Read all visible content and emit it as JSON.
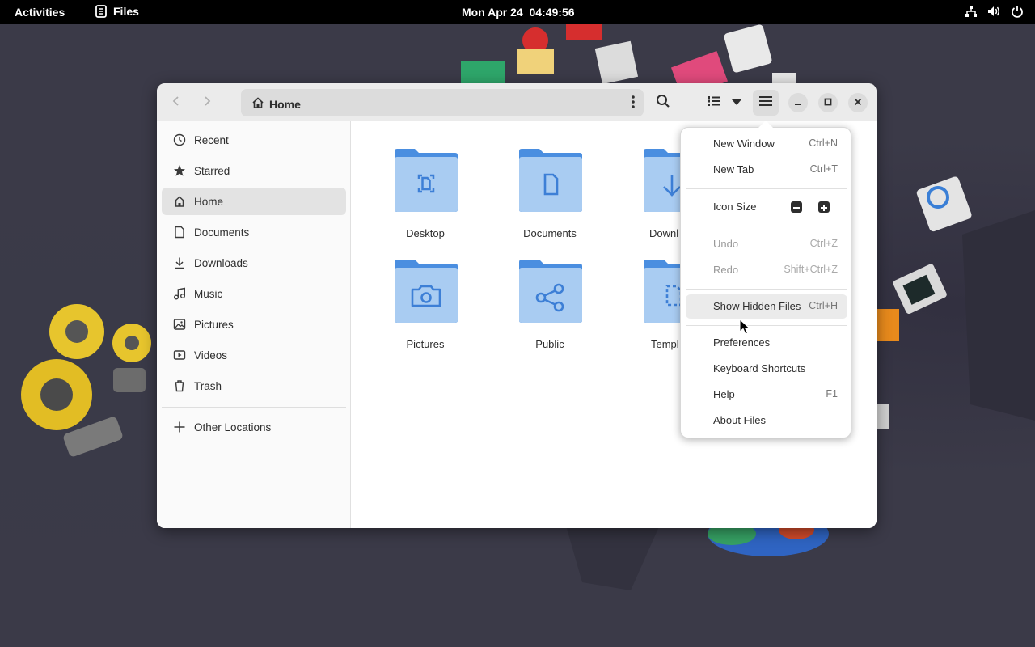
{
  "topbar": {
    "activities": "Activities",
    "app_name": "Files",
    "clock": "Mon Apr 24  04:49:56"
  },
  "window": {
    "path_label": "Home"
  },
  "sidebar": {
    "items": [
      {
        "label": "Recent",
        "icon": "clock-icon"
      },
      {
        "label": "Starred",
        "icon": "star-icon"
      },
      {
        "label": "Home",
        "icon": "home-icon"
      },
      {
        "label": "Documents",
        "icon": "document-icon"
      },
      {
        "label": "Downloads",
        "icon": "download-icon"
      },
      {
        "label": "Music",
        "icon": "music-icon"
      },
      {
        "label": "Pictures",
        "icon": "picture-icon"
      },
      {
        "label": "Videos",
        "icon": "video-icon"
      },
      {
        "label": "Trash",
        "icon": "trash-icon"
      }
    ],
    "other_locations": "Other Locations",
    "active": "Home"
  },
  "folders": [
    {
      "label": "Desktop",
      "icon": "desktop-folder-icon"
    },
    {
      "label": "Documents",
      "icon": "documents-folder-icon"
    },
    {
      "label": "Downl",
      "icon": "downloads-folder-icon"
    },
    {
      "label": "Pictures",
      "icon": "pictures-folder-icon"
    },
    {
      "label": "Public",
      "icon": "public-folder-icon"
    },
    {
      "label": "Templ",
      "icon": "templates-folder-icon"
    }
  ],
  "menu": {
    "new_window": {
      "label": "New Window",
      "shortcut": "Ctrl+N"
    },
    "new_tab": {
      "label": "New Tab",
      "shortcut": "Ctrl+T"
    },
    "icon_size": {
      "label": "Icon Size"
    },
    "undo": {
      "label": "Undo",
      "shortcut": "Ctrl+Z"
    },
    "redo": {
      "label": "Redo",
      "shortcut": "Shift+Ctrl+Z"
    },
    "show_hidden": {
      "label": "Show Hidden Files",
      "shortcut": "Ctrl+H"
    },
    "preferences": {
      "label": "Preferences"
    },
    "keyboard_shortcuts": {
      "label": "Keyboard Shortcuts"
    },
    "help": {
      "label": "Help",
      "shortcut": "F1"
    },
    "about": {
      "label": "About Files"
    }
  },
  "colors": {
    "folder_top": "#4a8ee0",
    "folder_body": "#a9ccf2",
    "folder_glyph": "#3d7fd6"
  }
}
